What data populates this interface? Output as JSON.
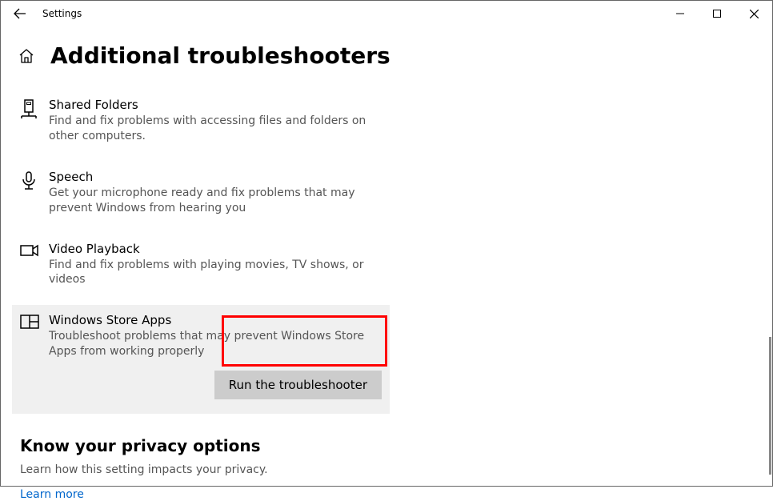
{
  "titlebar": {
    "title": "Settings"
  },
  "page": {
    "title": "Additional troubleshooters"
  },
  "troubleshooters": [
    {
      "title": "Shared Folders",
      "desc": "Find and fix problems with accessing files and folders on other computers."
    },
    {
      "title": "Speech",
      "desc": "Get your microphone ready and fix problems that may prevent Windows from hearing you"
    },
    {
      "title": "Video Playback",
      "desc": "Find and fix problems with playing movies, TV shows, or videos"
    },
    {
      "title": "Windows Store Apps",
      "desc": "Troubleshoot problems that may prevent Windows Store Apps from working properly"
    }
  ],
  "run_button": "Run the troubleshooter",
  "privacy": {
    "title": "Know your privacy options",
    "desc": "Learn how this setting impacts your privacy.",
    "link": "Learn more"
  }
}
